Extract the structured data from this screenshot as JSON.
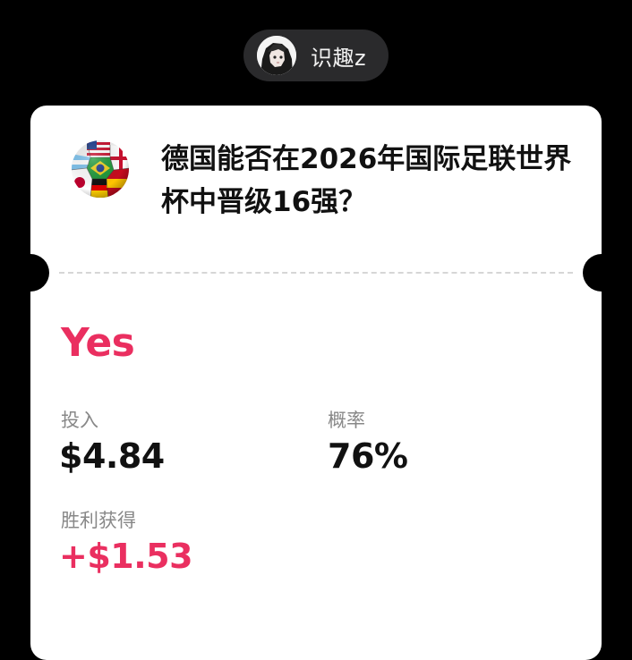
{
  "user": {
    "name": "识趣z"
  },
  "market": {
    "question": "德国能否在2026年国际足联世界杯中晋级16强？",
    "outcome": "Yes"
  },
  "stats": {
    "invest_label": "投入",
    "invest_value": "$4.84",
    "probability_label": "概率",
    "probability_value": "76%",
    "winnings_label": "胜利获得",
    "winnings_value": "+$1.53"
  },
  "colors": {
    "background": "#000000",
    "card": "#ffffff",
    "accent_pink": "#ea2f60",
    "label_gray": "#888888",
    "chip": "#2a2a2c"
  },
  "icons": {
    "avatar": "anime-character-avatar",
    "market": "flag-soccer-ball-icon"
  }
}
